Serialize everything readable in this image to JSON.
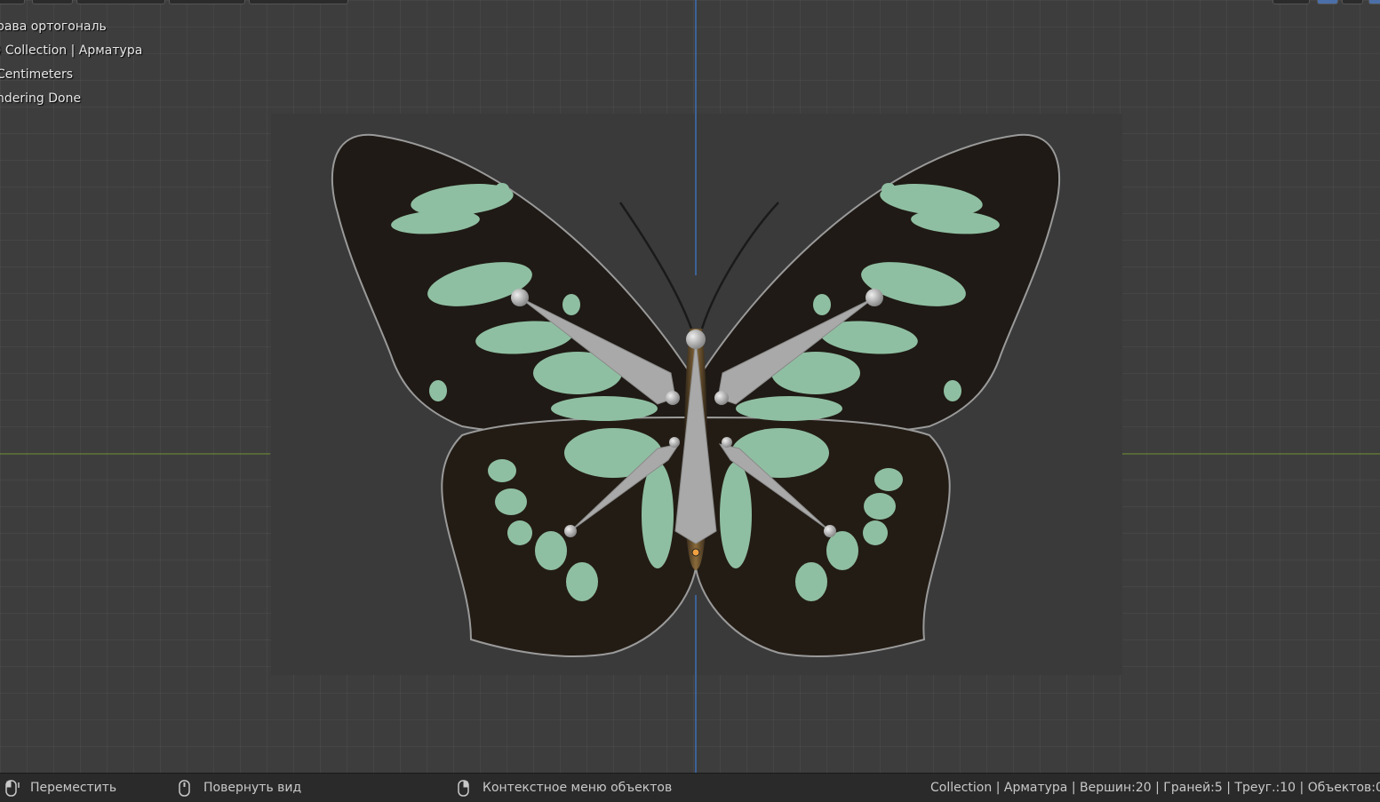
{
  "viewport": {
    "overlay": {
      "view_name": "рава ортогональ",
      "collection": ") Collection | Арматура",
      "units": "Centimeters",
      "render_status": "ndering Done"
    }
  },
  "statusbar": {
    "hints": [
      {
        "icon": "mouse-left-icon",
        "label": "Переместить"
      },
      {
        "icon": "mouse-middle-icon",
        "label": "Повернуть вид"
      },
      {
        "icon": "mouse-right-icon",
        "label": "Контекстное меню объектов"
      }
    ],
    "stats": "Collection | Арматура | Вершин:20 | Граней:5 | Треуг.:10 | Объектов:0/"
  },
  "colors": {
    "viewport_bg": "#3d3d3d",
    "axis_x": "#6e8c2e",
    "axis_z": "#3d6fb6",
    "bone": "#a9a9a9",
    "wing_dark": "#1f1a15",
    "wing_spot": "#8fbfa2"
  }
}
